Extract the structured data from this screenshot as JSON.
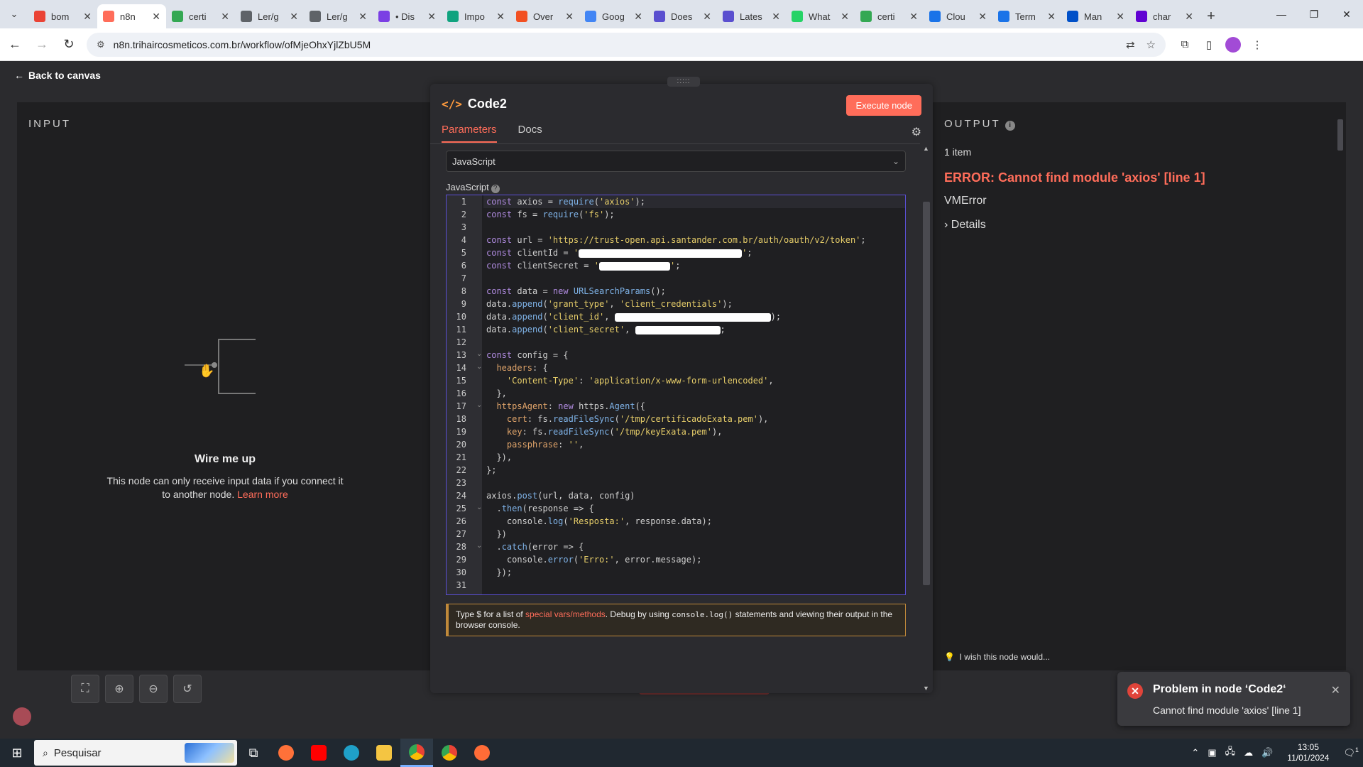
{
  "browser": {
    "tabs": [
      {
        "title": "bom",
        "color": "#ea4335"
      },
      {
        "title": "n8n",
        "color": "#ff6d5a",
        "active": true
      },
      {
        "title": "certi",
        "color": "#34a853"
      },
      {
        "title": "Ler/g",
        "color": "#5f6368"
      },
      {
        "title": "Ler/g",
        "color": "#5f6368"
      },
      {
        "title": "• Dis",
        "color": "#7b3fe4"
      },
      {
        "title": "Impo",
        "color": "#10a37f"
      },
      {
        "title": "Over",
        "color": "#f25022"
      },
      {
        "title": "Goog",
        "color": "#4285f4"
      },
      {
        "title": "Does",
        "color": "#5a4fcf"
      },
      {
        "title": "Lates",
        "color": "#5a4fcf"
      },
      {
        "title": "What",
        "color": "#25d366"
      },
      {
        "title": "certi",
        "color": "#34a853"
      },
      {
        "title": "Clou",
        "color": "#1a73e8"
      },
      {
        "title": "Term",
        "color": "#1a73e8"
      },
      {
        "title": "Man",
        "color": "#0050c8"
      },
      {
        "title": "char",
        "color": "#6001d2"
      }
    ],
    "url": "n8n.trihaircosmeticos.com.br/workflow/ofMjeOhxYjlZbU5M"
  },
  "app": {
    "back_label": "Back to canvas",
    "input": {
      "title": "INPUT",
      "wire_title": "Wire me up",
      "wire_text": "This node can only receive input data if you connect it to another node.",
      "learn_more": "Learn more"
    },
    "node": {
      "title": "Code2",
      "execute_label": "Execute node",
      "tabs": [
        "Parameters",
        "Docs"
      ],
      "language_value": "JavaScript",
      "editor_label": "JavaScript",
      "hint_prefix": "Type $ for a list of ",
      "hint_link": "special vars/methods",
      "hint_middle": ". Debug by using ",
      "hint_code": "console.log()",
      "hint_suffix": " statements and viewing their output in the browser console."
    },
    "output": {
      "title": "OUTPUT",
      "item_count": "1 item",
      "error_title": "ERROR: Cannot find module 'axios' [line 1]",
      "error_type": "VMError",
      "details_label": "Details",
      "wish_text": "I wish this node would..."
    },
    "toast": {
      "title": "Problem in node ‘Code2‘",
      "message": "Cannot find module 'axios' [line 1]"
    }
  },
  "taskbar": {
    "search_placeholder": "Pesquisar",
    "time": "13:05",
    "date": "11/01/2024",
    "notification_count": "1"
  }
}
